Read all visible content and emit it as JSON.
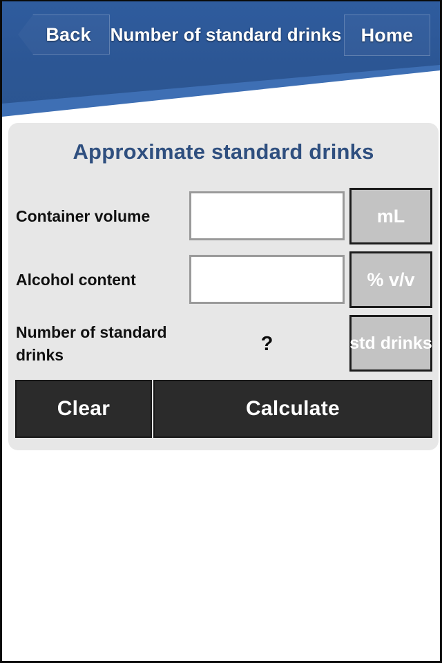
{
  "header": {
    "back_label": "Back",
    "title": "Number of standard drinks",
    "home_label": "Home",
    "back_icon": "chevron-left-icon",
    "band_color": "#2c5694",
    "stripe_color": "#3e6fb4"
  },
  "card": {
    "title": "Approximate standard drinks",
    "title_color": "#2f4f7f",
    "background_color": "#e7e7e7",
    "rows": [
      {
        "label": "Container volume",
        "input_value": "",
        "input_placeholder": "",
        "unit": "mL",
        "type": "input"
      },
      {
        "label": "Alcohol content",
        "input_value": "",
        "input_placeholder": "",
        "unit": "% v/v",
        "type": "input"
      },
      {
        "label": "Number of standard drinks",
        "result_value": "?",
        "unit": "std drinks",
        "type": "result"
      }
    ],
    "actions": {
      "clear_label": "Clear",
      "calculate_label": "Calculate",
      "button_color": "#2b2b2b"
    }
  }
}
